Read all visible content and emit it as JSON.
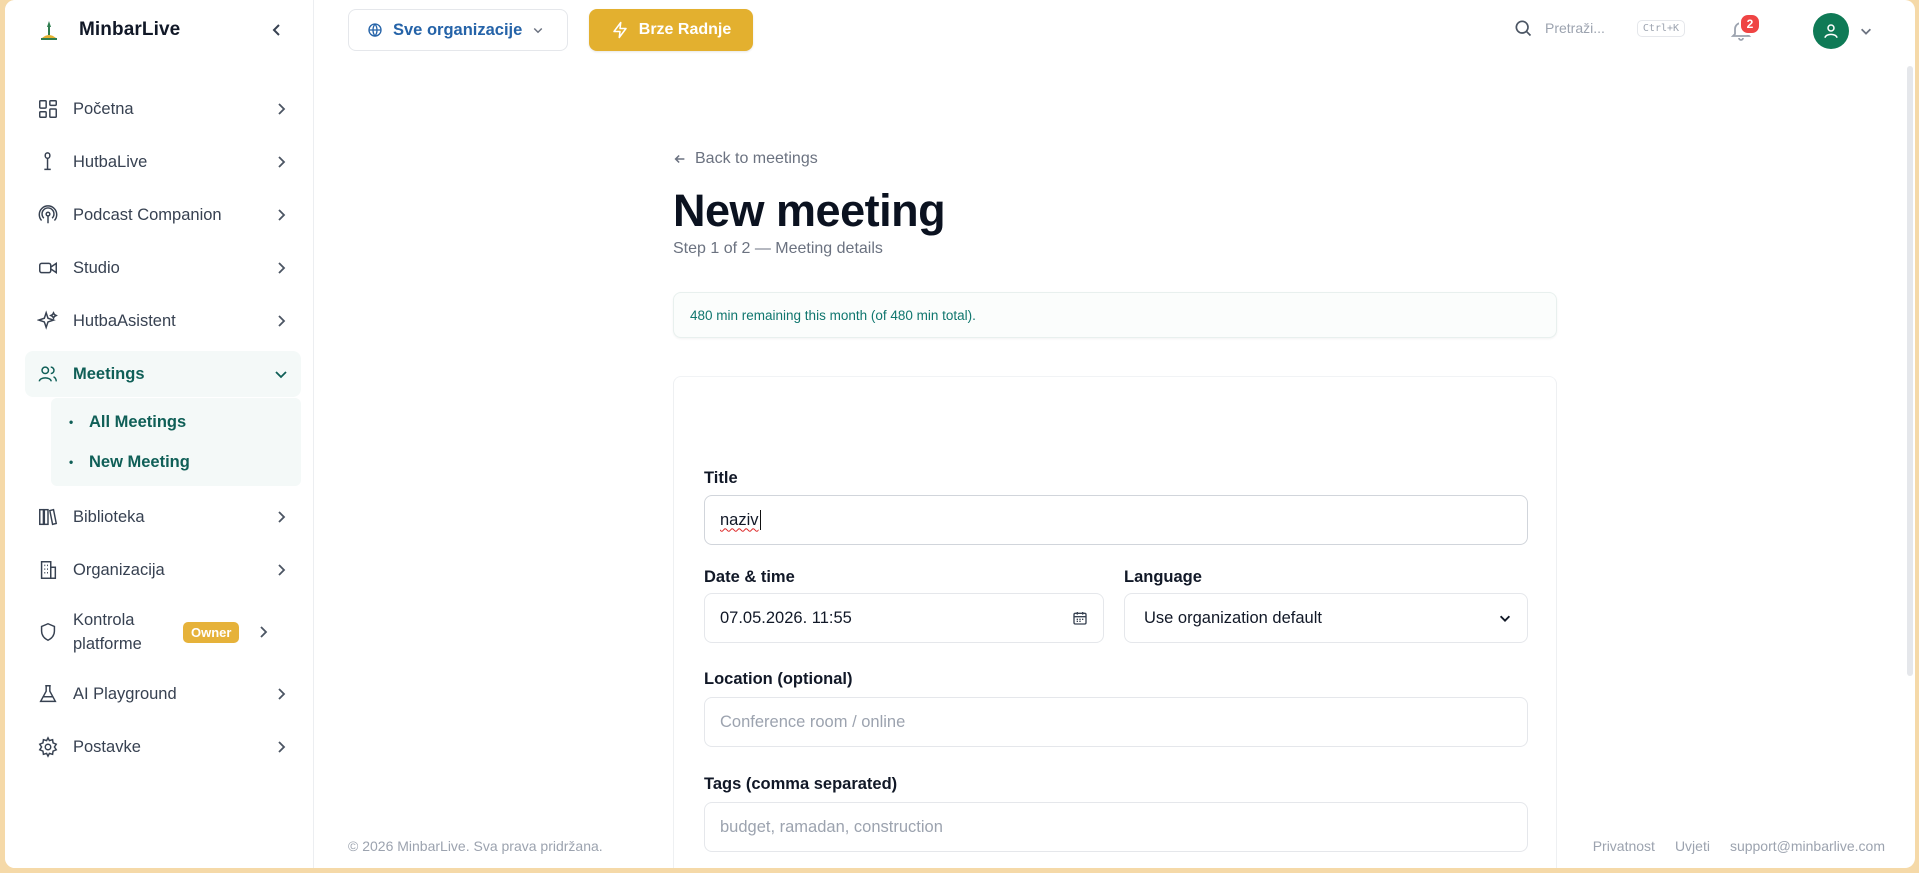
{
  "brand": {
    "name": "MinbarLive"
  },
  "sidebar": {
    "items": [
      {
        "label": "Početna",
        "icon": "dashboard-grid-icon"
      },
      {
        "label": "HutbaLive",
        "icon": "microphone-stand-icon"
      },
      {
        "label": "Podcast Companion",
        "icon": "podcast-icon"
      },
      {
        "label": "Studio",
        "icon": "video-camera-icon"
      },
      {
        "label": "HutbaAsistent",
        "icon": "sparkles-icon"
      },
      {
        "label": "Meetings",
        "icon": "users-icon",
        "active": true,
        "children": [
          {
            "label": "All Meetings"
          },
          {
            "label": "New Meeting"
          }
        ]
      },
      {
        "label": "Biblioteka",
        "icon": "library-books-icon"
      },
      {
        "label": "Organizacija",
        "icon": "building-icon"
      },
      {
        "label": "Kontrola platforme",
        "icon": "shield-icon",
        "badge": "Owner"
      },
      {
        "label": "AI Playground",
        "icon": "flask-icon"
      },
      {
        "label": "Postavke",
        "icon": "settings-gear-icon"
      }
    ]
  },
  "topbar": {
    "org_selector": "Sve organizacije",
    "quick_actions": "Brze Radnje",
    "search_placeholder": "Pretraži...",
    "search_shortcut": "Ctrl+K",
    "notifications_count": "2"
  },
  "page": {
    "back_link": "Back to meetings",
    "title": "New meeting",
    "step": "Step 1 of 2 — Meeting details",
    "notice": "480 min remaining this month (of 480 min total)."
  },
  "form": {
    "title_label": "Title",
    "title_value": "naziv",
    "datetime_label": "Date & time",
    "datetime_value": "07.05.2026. 11:55",
    "language_label": "Language",
    "language_value": "Use organization default",
    "location_label": "Location (optional)",
    "location_placeholder": "Conference room / online",
    "tags_label": "Tags (comma separated)",
    "tags_placeholder": "budget, ramadan, construction"
  },
  "footer": {
    "copyright": "© 2026 MinbarLive. Sva prava pridržana.",
    "links": [
      "Privatnost",
      "Uvjeti",
      "support@minbarlive.com"
    ]
  },
  "colors": {
    "accent": "#0f5f57",
    "quick_actions": "#e3b02f",
    "owner_badge": "#e6b23a",
    "notification_badge": "#ef4444",
    "avatar": "#0f7a56"
  }
}
